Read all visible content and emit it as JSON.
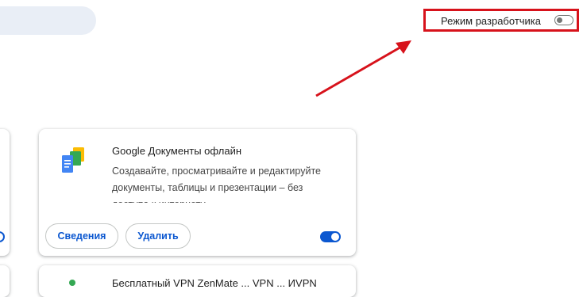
{
  "header": {
    "dev_mode_label": "Режим разработчика",
    "dev_mode_enabled": false
  },
  "extension": {
    "title": "Google Документы офлайн",
    "description": "Создавайте, просматривайте и редактируйте документы, таблицы и презентации – без доступа к интернету.",
    "details_label": "Сведения",
    "remove_label": "Удалить",
    "enabled": true,
    "icon": "google-docs-offline-icon"
  },
  "next_extension": {
    "title": "Бесплатный VPN ZenMate ... VPN ... ИVPN"
  },
  "colors": {
    "highlight": "#d7121b",
    "accent": "#0b57d0"
  }
}
